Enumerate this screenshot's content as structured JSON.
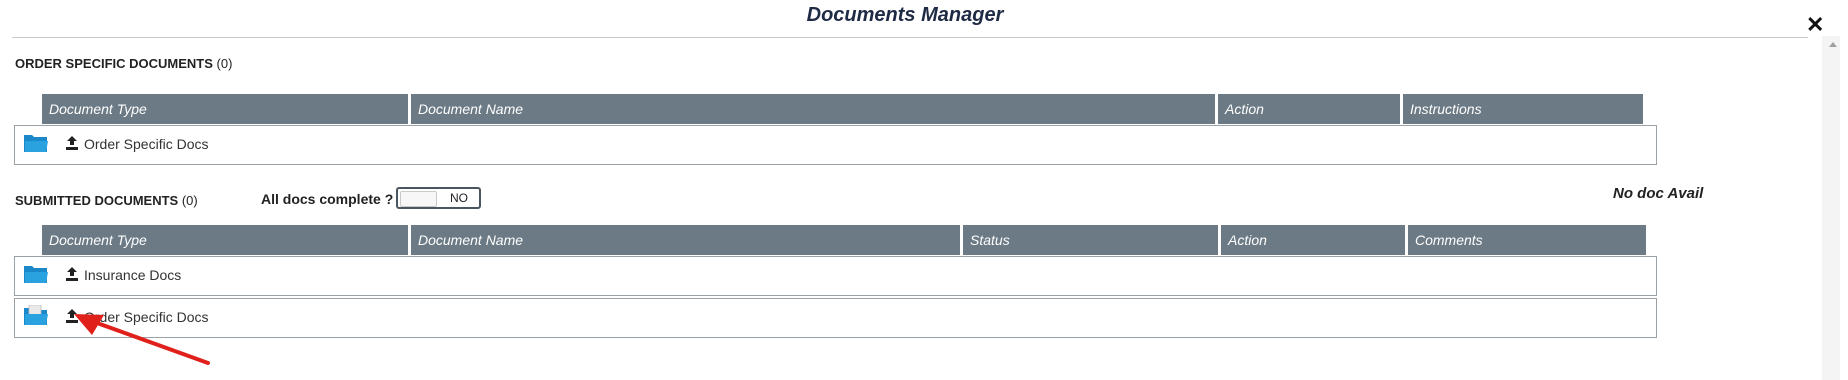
{
  "modal": {
    "title": "Documents Manager",
    "close_icon": "close-icon"
  },
  "order_section": {
    "title": "ORDER SPECIFIC DOCUMENTS",
    "count": "(0)",
    "columns": [
      "Document Type",
      "Document Name",
      "Action",
      "Instructions"
    ],
    "rows": [
      {
        "label": "Order Specific Docs",
        "folder_icon": "folder-open-icon",
        "upload_icon": "upload-icon"
      }
    ]
  },
  "submitted_section": {
    "title": "SUBMITTED DOCUMENTS",
    "count": "(0)",
    "toggle_label": "All docs complete ?",
    "toggle_state": "NO",
    "no_doc_text": "No doc Avail",
    "columns": [
      "Document Type",
      "Document Name",
      "Status",
      "Action",
      "Comments"
    ],
    "rows": [
      {
        "label": "Insurance Docs",
        "folder_icon": "folder-open-icon",
        "upload_icon": "upload-icon"
      },
      {
        "label": "Order Specific Docs",
        "folder_icon": "folder-open-icon",
        "upload_icon": "upload-icon"
      }
    ]
  },
  "colors": {
    "header_bg": "#6b7a84",
    "folder_blue": "#1a88c9",
    "annotation_red": "#e0201b"
  }
}
